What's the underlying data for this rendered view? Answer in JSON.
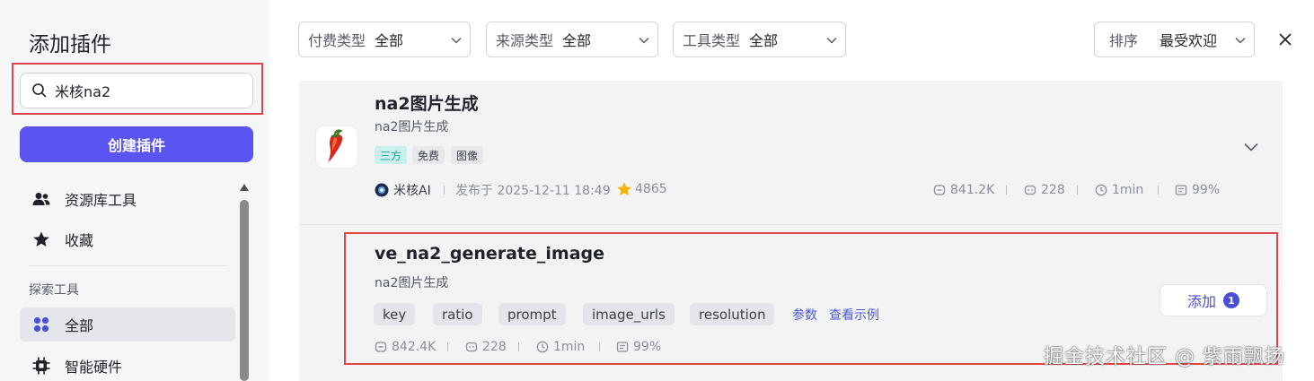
{
  "sidebar": {
    "title": "添加插件",
    "search_value": "米核na2",
    "create_button": "创建插件",
    "items": [
      {
        "label": "资源库工具",
        "icon": "users-icon"
      },
      {
        "label": "收藏",
        "icon": "star-icon"
      }
    ],
    "section_label": "探索工具",
    "explore_items": [
      {
        "label": "全部",
        "icon": "grid-icon",
        "active": true
      },
      {
        "label": "智能硬件",
        "icon": "chip-icon"
      }
    ]
  },
  "filters": [
    {
      "label": "付费类型",
      "value": "全部"
    },
    {
      "label": "来源类型",
      "value": "全部"
    },
    {
      "label": "工具类型",
      "value": "全部"
    }
  ],
  "sort": {
    "label": "排序",
    "value": "最受欢迎"
  },
  "plugin": {
    "title": "na2图片生成",
    "subtitle": "na2图片生成",
    "tags": [
      "三方",
      "免费",
      "图像"
    ],
    "author": "米核AI",
    "published": "发布于 2025-12-11 18:49",
    "stars": "4865",
    "stats": {
      "calls": "841.2K",
      "bots": "228",
      "duration": "1min",
      "success": "99%"
    }
  },
  "tool": {
    "title": "ve_na2_generate_image",
    "subtitle": "na2图片生成",
    "params": [
      "key",
      "ratio",
      "prompt",
      "image_urls",
      "resolution"
    ],
    "params_link": "参数",
    "example_link": "查看示例",
    "add_label": "添加",
    "add_count": "1",
    "stats": {
      "calls": "842.4K",
      "bots": "228",
      "duration": "1min",
      "success": "99%"
    }
  },
  "watermark": "掘金技术社区 @ 紫雨飘扬",
  "colors": {
    "accent": "#5a55f0",
    "highlight": "#e0454a",
    "link": "#4a58d6"
  }
}
